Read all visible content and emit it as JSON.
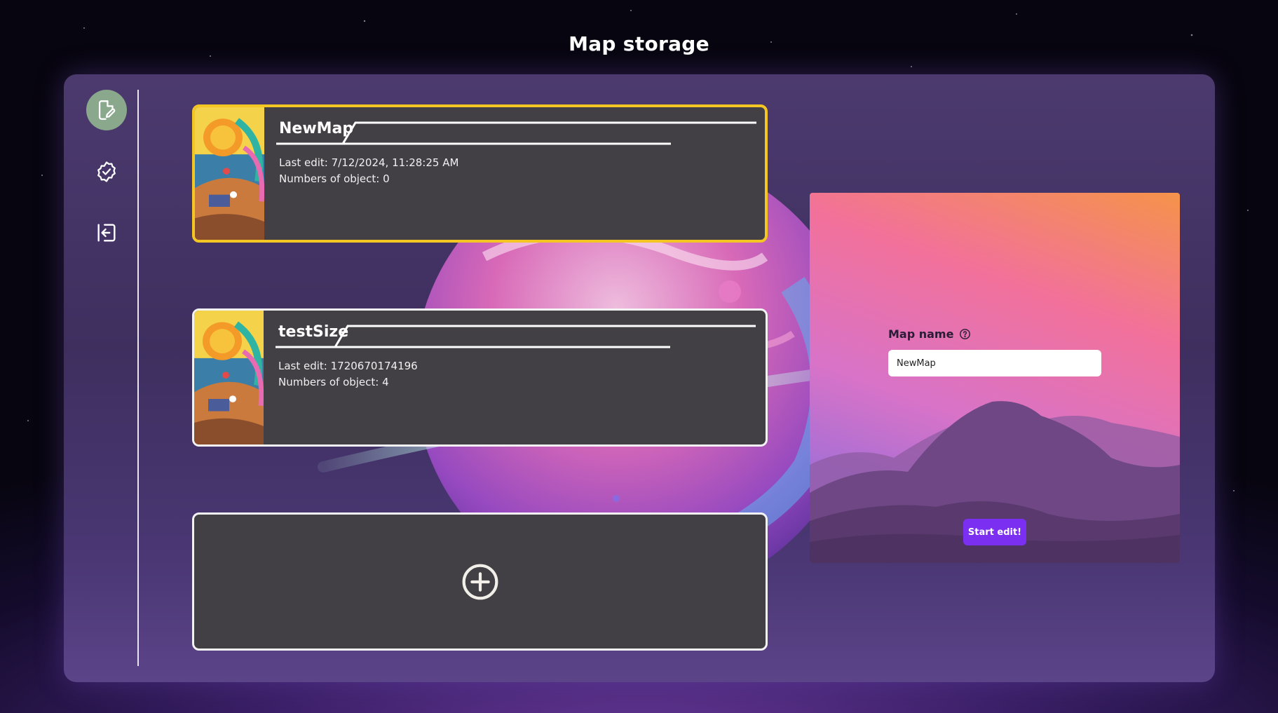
{
  "page": {
    "title": "Map storage"
  },
  "sidebar": {
    "items": [
      {
        "icon": "edit-document-icon",
        "active": true
      },
      {
        "icon": "verified-badge-icon",
        "active": false
      },
      {
        "icon": "logout-icon",
        "active": false
      }
    ]
  },
  "maps": [
    {
      "name": "NewMap",
      "last_edit": "Last edit: 7/12/2024, 11:28:25 AM",
      "objects": "Numbers of object: 0",
      "selected": true
    },
    {
      "name": "testSize",
      "last_edit": "Last edit: 1720670174196",
      "objects": "Numbers of object: 4",
      "selected": false
    }
  ],
  "add_card": {
    "icon": "plus-circle-icon"
  },
  "editor": {
    "map_name_label": "Map name",
    "map_name_value": "NewMap",
    "help_icon": "help-circle-icon",
    "start_label": "Start edit!"
  },
  "colors": {
    "selected_border": "#f3c623",
    "card_bg": "#423f45",
    "accent_button": "#7b2ff0",
    "active_sidebar": "#8aa88c"
  }
}
